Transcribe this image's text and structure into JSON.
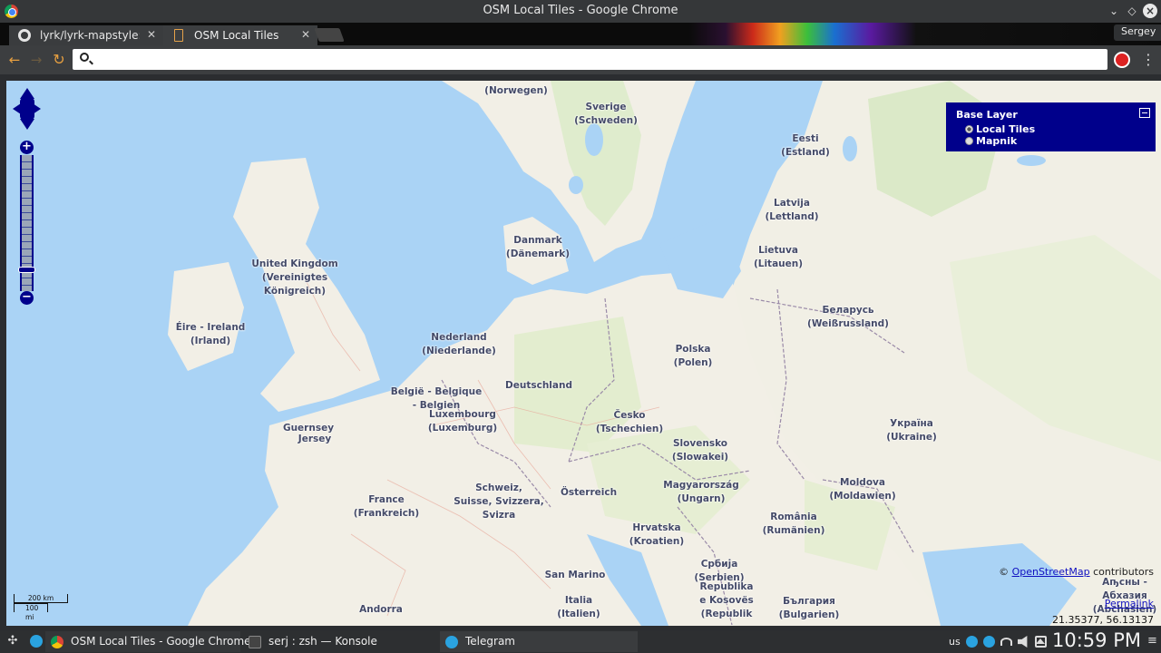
{
  "window": {
    "title": "OSM Local Tiles - Google Chrome"
  },
  "tabs": [
    {
      "label": "lyrk/lyrk-mapstyle: The",
      "icon": "github-icon"
    },
    {
      "label": "OSM Local Tiles",
      "icon": "page-icon"
    }
  ],
  "profile": {
    "name": "Sergey"
  },
  "omnibox": {
    "value": "",
    "placeholder": ""
  },
  "map": {
    "layer_switcher": {
      "title": "Base Layer",
      "options": [
        {
          "label": "Local Tiles",
          "selected": true
        },
        {
          "label": "Mapnik",
          "selected": false
        }
      ]
    },
    "attribution": {
      "prefix": "©",
      "link": "OpenStreetMap",
      "suffix": "contributors"
    },
    "permalink": "Permalink",
    "mouse_position": "21.35377, 56.13137",
    "scale": {
      "km": "200 km",
      "mi": "100 mi"
    },
    "places": [
      "(Norwegen)",
      "Sverige\n(Schweden)",
      "Eesti\n(Estland)",
      "Latvija\n(Lettland)",
      "Lietuva\n(Litauen)",
      "Danmark\n(Dänemark)",
      "United Kingdom\n(Vereinigtes\nKönigreich)",
      "Éire - Ireland\n(Irland)",
      "Nederland\n(Niederlande)",
      "België - Belgique\n- Belgien",
      "Luxembourg\n(Luxemburg)",
      "Deutschland",
      "Polska\n(Polen)",
      "Беларусь\n(Weißrussland)",
      "Україна\n(Ukraine)",
      "Česko\n(Tschechien)",
      "Slovensko\n(Slowakei)",
      "Guernsey",
      "Jersey",
      "France\n(Frankreich)",
      "Schweiz,\nSuisse, Svizzera,\nSvizra",
      "Österreich",
      "Magyarország\n(Ungarn)",
      "Moldova\n(Moldawien)",
      "România\n(Rumänien)",
      "Hrvatska\n(Kroatien)",
      "Србија\n(Serbien)",
      "Republika\ne Kosovës\n(Republik",
      "България\n(Bulgarien)",
      "San Marino",
      "Italia\n(Italien)",
      "Andorra",
      "Аҧсны -\nАбхазия\n(Abchasien)"
    ]
  },
  "taskbar": {
    "tasks": [
      {
        "label": "OSM Local Tiles - Google Chrome"
      },
      {
        "label": "serj : zsh — Konsole"
      },
      {
        "label": "Telegram"
      }
    ],
    "keyboard_layout": "us",
    "clock": "10:59 PM"
  }
}
